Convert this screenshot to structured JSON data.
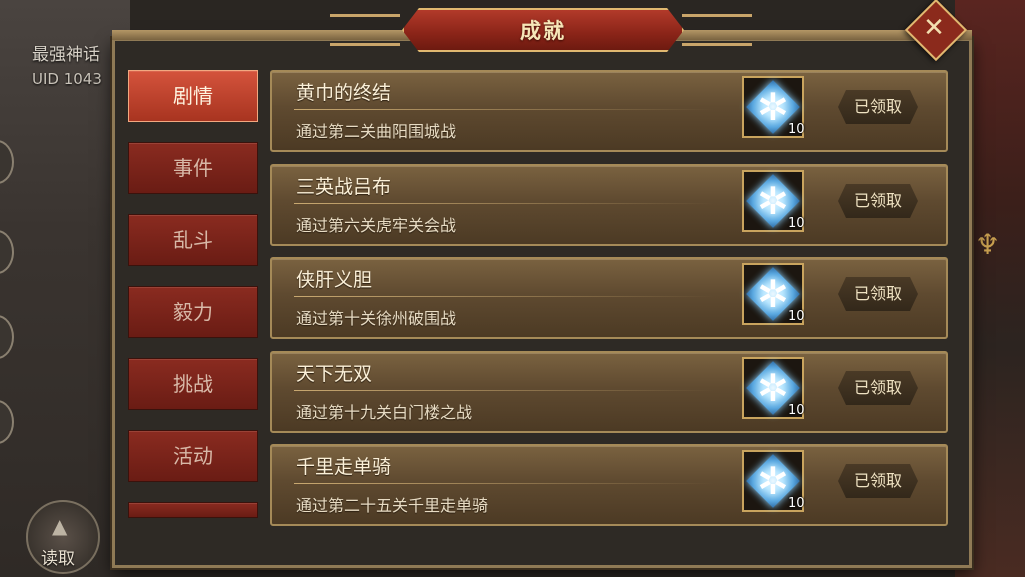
{
  "title": "成就",
  "player": {
    "name": "最强神话",
    "uid": "UID 1043"
  },
  "read_label": "读取",
  "tabs": [
    {
      "label": "剧情",
      "active": true
    },
    {
      "label": "事件",
      "active": false
    },
    {
      "label": "乱斗",
      "active": false
    },
    {
      "label": "毅力",
      "active": false
    },
    {
      "label": "挑战",
      "active": false
    },
    {
      "label": "活动",
      "active": false
    }
  ],
  "achievements": [
    {
      "title": "黄巾的终结",
      "desc": "通过第二关曲阳围城战",
      "reward_count": "10",
      "button": "已领取"
    },
    {
      "title": "三英战吕布",
      "desc": "通过第六关虎牢关会战",
      "reward_count": "10",
      "button": "已领取"
    },
    {
      "title": "侠肝义胆",
      "desc": "通过第十关徐州破围战",
      "reward_count": "10",
      "button": "已领取"
    },
    {
      "title": "天下无双",
      "desc": "通过第十九关白门楼之战",
      "reward_count": "10",
      "button": "已领取"
    },
    {
      "title": "千里走单骑",
      "desc": "通过第二十五关千里走单骑",
      "reward_count": "10",
      "button": "已领取"
    }
  ],
  "icons": {
    "reward": "diamond-gem-icon",
    "close": "close-icon"
  }
}
